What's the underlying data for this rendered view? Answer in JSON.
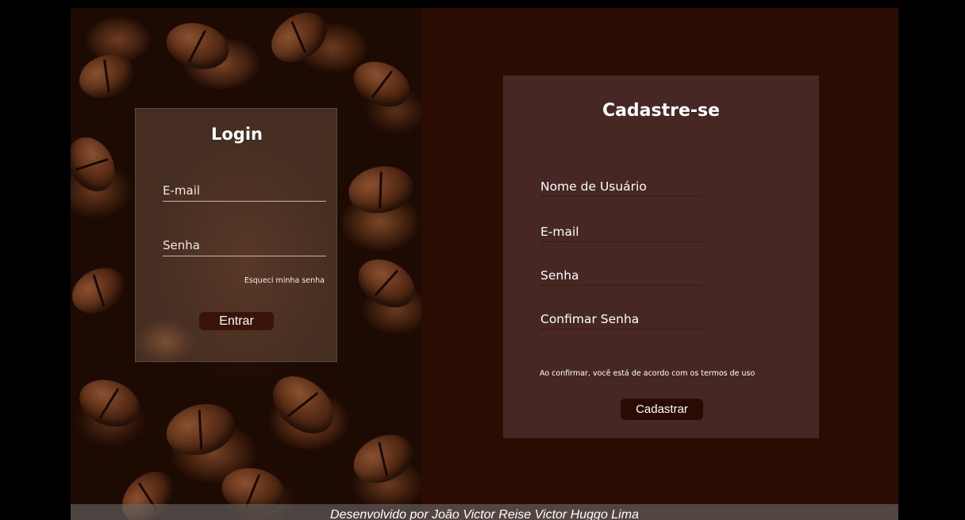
{
  "login": {
    "title": "Login",
    "email_placeholder": "E-mail",
    "password_placeholder": "Senha",
    "forgot_link": "Esqueci minha senha",
    "submit_label": "Entrar"
  },
  "register": {
    "title": "Cadastre-se",
    "username_placeholder": "Nome de Usuário",
    "email_placeholder": "E-mail",
    "password_placeholder": "Senha",
    "confirm_placeholder": "Confimar Senha",
    "terms_text": "Ao confirmar, você está de acordo com os termos de uso",
    "submit_label": "Cadastrar"
  },
  "footer": {
    "credit": "Desenvolvido por João Victor Reise Victor Huggo Lima"
  },
  "colors": {
    "right_panel_bg": "#2b0c02",
    "register_card_bg": "#472723",
    "button_bg": "#3a1409"
  }
}
